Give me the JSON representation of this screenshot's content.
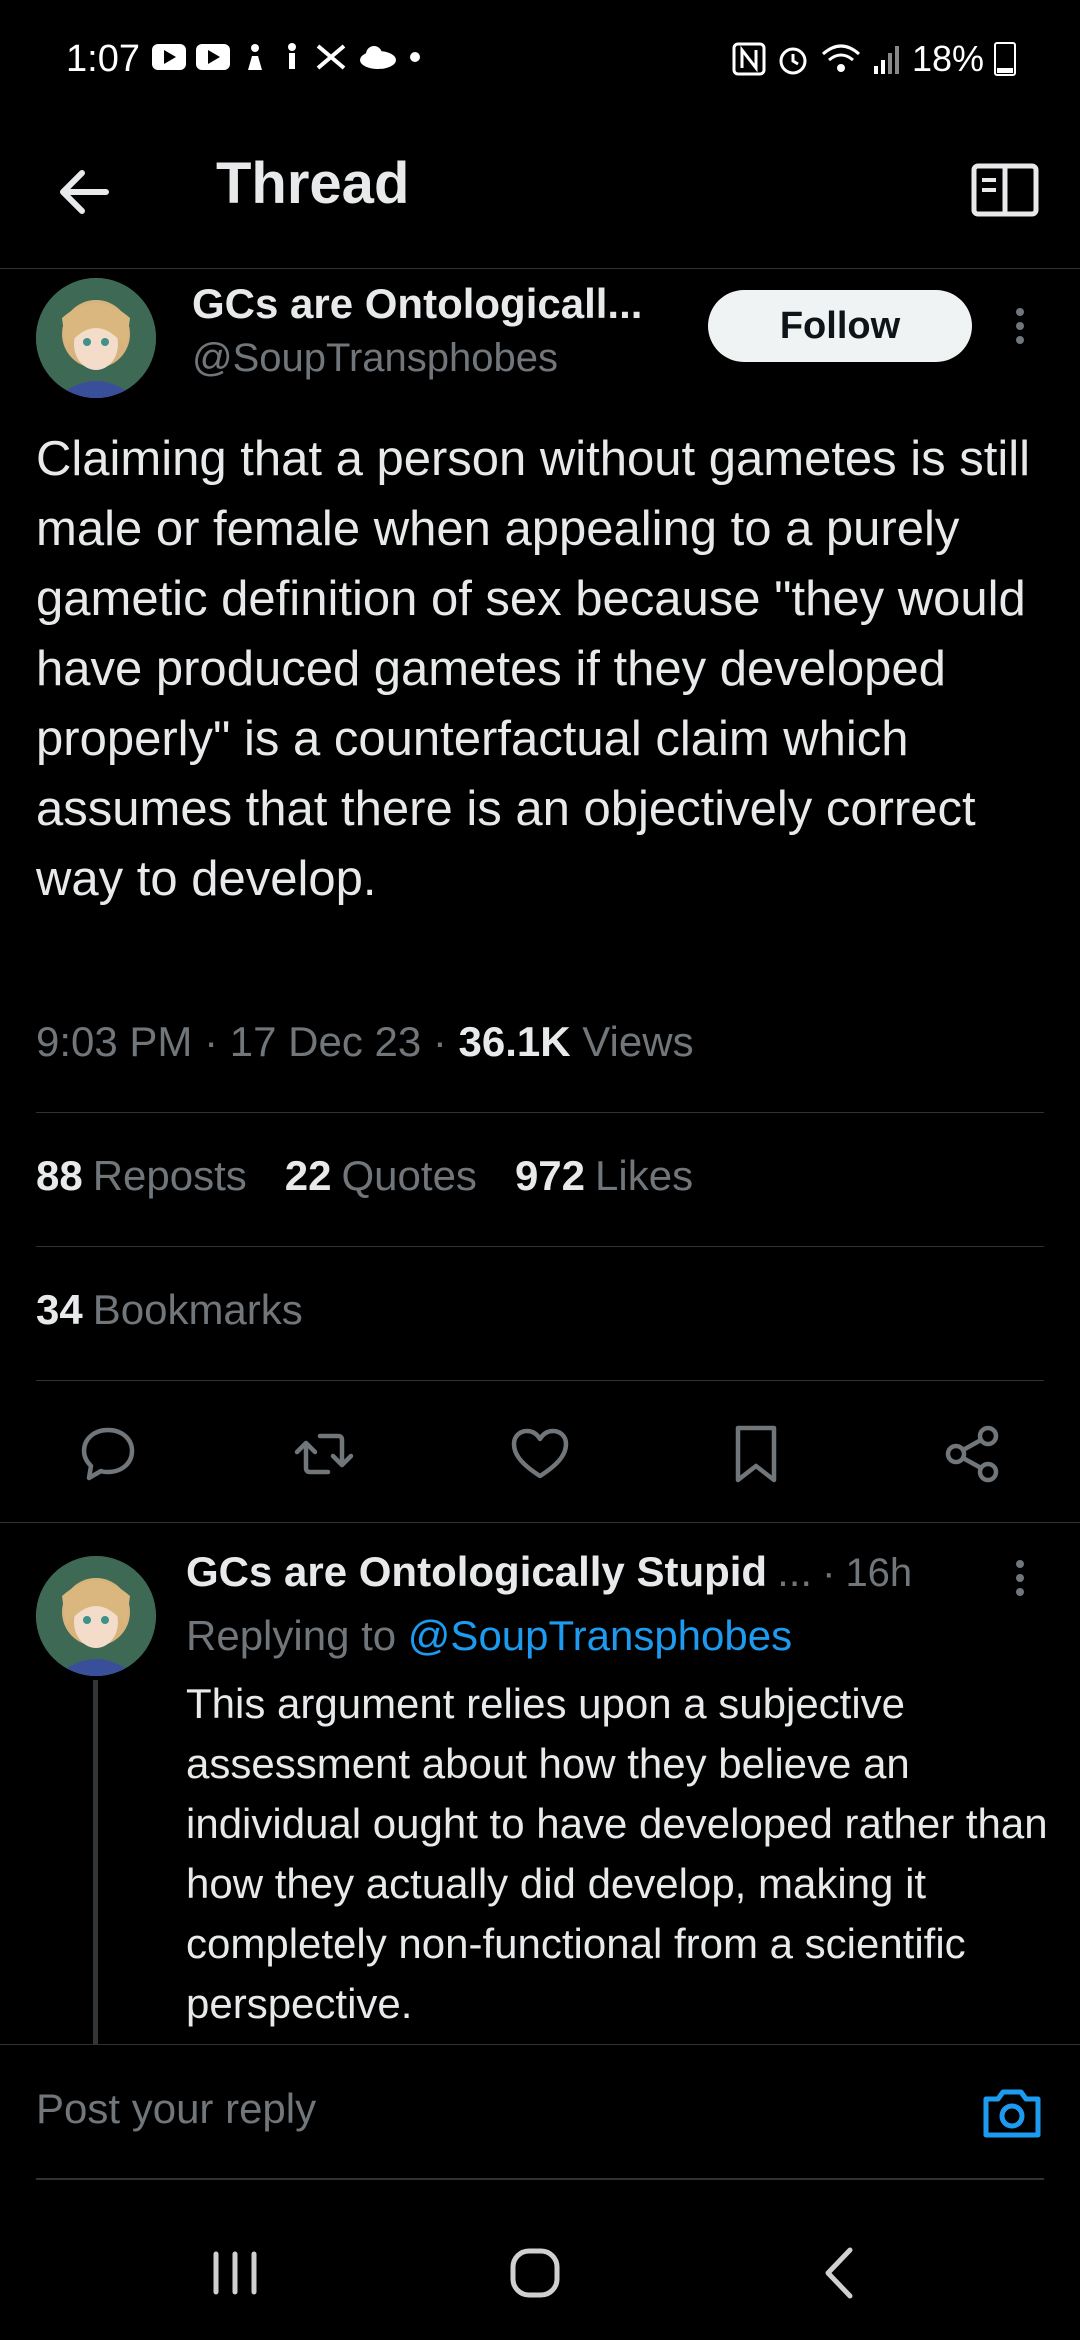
{
  "status_bar": {
    "time": "1:07",
    "battery": "18%"
  },
  "header": {
    "title": "Thread"
  },
  "tweet": {
    "author_name": "GCs are Ontologicall...",
    "author_handle": "@SoupTransphobes",
    "follow_label": "Follow",
    "text": "Claiming that a person without gametes is still male or female when appealing to a purely gametic definition of sex because \"they would have produced gametes if they developed properly\" is a counterfactual claim which assumes that there is an objectively correct way to develop.",
    "time": "9:03 PM",
    "date": "17 Dec 23",
    "views_count": "36.1K",
    "views_label": "Views",
    "reposts_count": "88",
    "reposts_label": "Reposts",
    "quotes_count": "22",
    "quotes_label": "Quotes",
    "likes_count": "972",
    "likes_label": "Likes",
    "bookmarks_count": "34",
    "bookmarks_label": "Bookmarks"
  },
  "reply": {
    "author_name": "GCs are Ontologically Stupid",
    "ellipsis": "...",
    "time": "16h",
    "replying_prefix": "Replying to",
    "replying_handle": "@SoupTransphobes",
    "text": "This argument relies upon a subjective assessment about how they believe an individual ought to have developed rather than how they actually did develop, making it completely non-functional from a scientific perspective."
  },
  "composer": {
    "placeholder": "Post your reply"
  },
  "colors": {
    "background": "#000000",
    "text_primary": "#e7e9ea",
    "text_secondary": "#71767b",
    "link": "#1d9bf0",
    "divider": "#2f3336"
  },
  "icons": {
    "back": "arrow-left-icon",
    "reader": "book-open-icon",
    "reply": "speech-bubble-icon",
    "repost": "repost-arrows-icon",
    "like": "heart-icon",
    "bookmark": "bookmark-icon",
    "share": "share-icon",
    "camera": "camera-icon"
  }
}
